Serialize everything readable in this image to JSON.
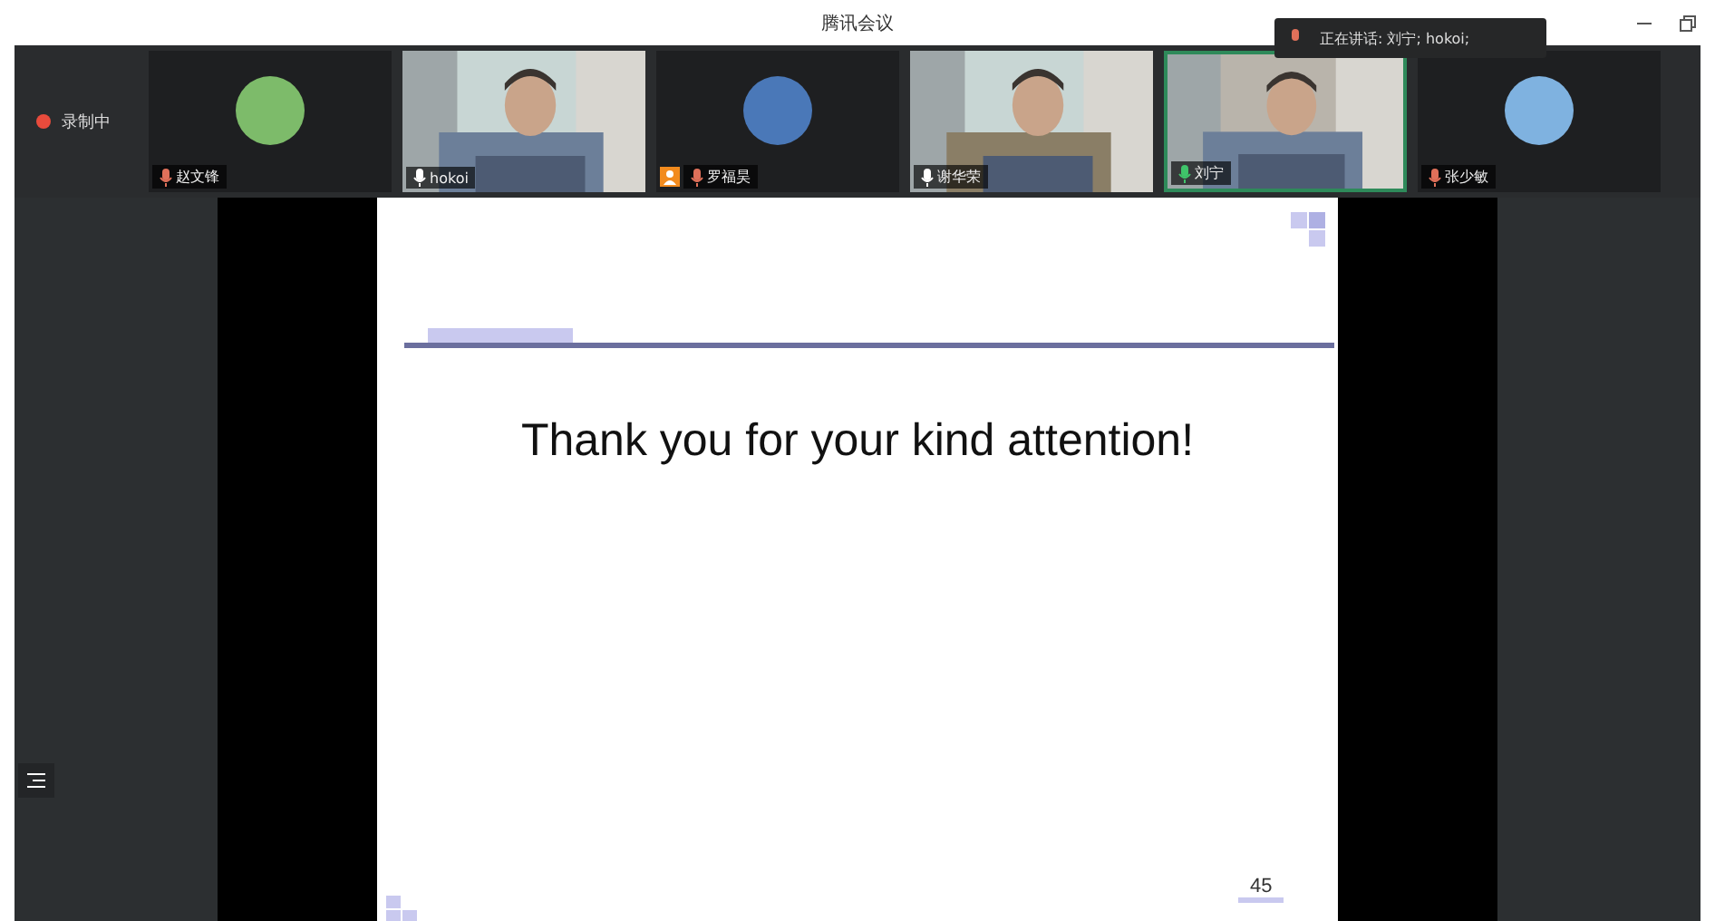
{
  "window": {
    "title": "腾讯会议"
  },
  "recording": {
    "label": "录制中",
    "on": true
  },
  "speaking_notice": {
    "text": "正在讲话: 刘宁; hokoi;"
  },
  "tiles": [
    {
      "name": "赵文锋",
      "kind": "avatar",
      "color": "#7dbb6a",
      "muted": true,
      "speaking": false,
      "host": false
    },
    {
      "name": "hokoi",
      "kind": "video",
      "muted": false,
      "speaking": false,
      "host": false
    },
    {
      "name": "罗福昊",
      "kind": "avatar",
      "color": "#4a78b8",
      "muted": true,
      "speaking": false,
      "host": true
    },
    {
      "name": "谢华荣",
      "kind": "video",
      "muted": false,
      "speaking": false,
      "host": false
    },
    {
      "name": "刘宁",
      "kind": "video",
      "muted": false,
      "speaking": true,
      "host": false
    },
    {
      "name": "张少敏",
      "kind": "avatar",
      "color": "#7fb2e0",
      "muted": true,
      "speaking": false,
      "host": false
    }
  ],
  "slide": {
    "title": "Thank you for your kind attention!",
    "page_number": "45"
  }
}
